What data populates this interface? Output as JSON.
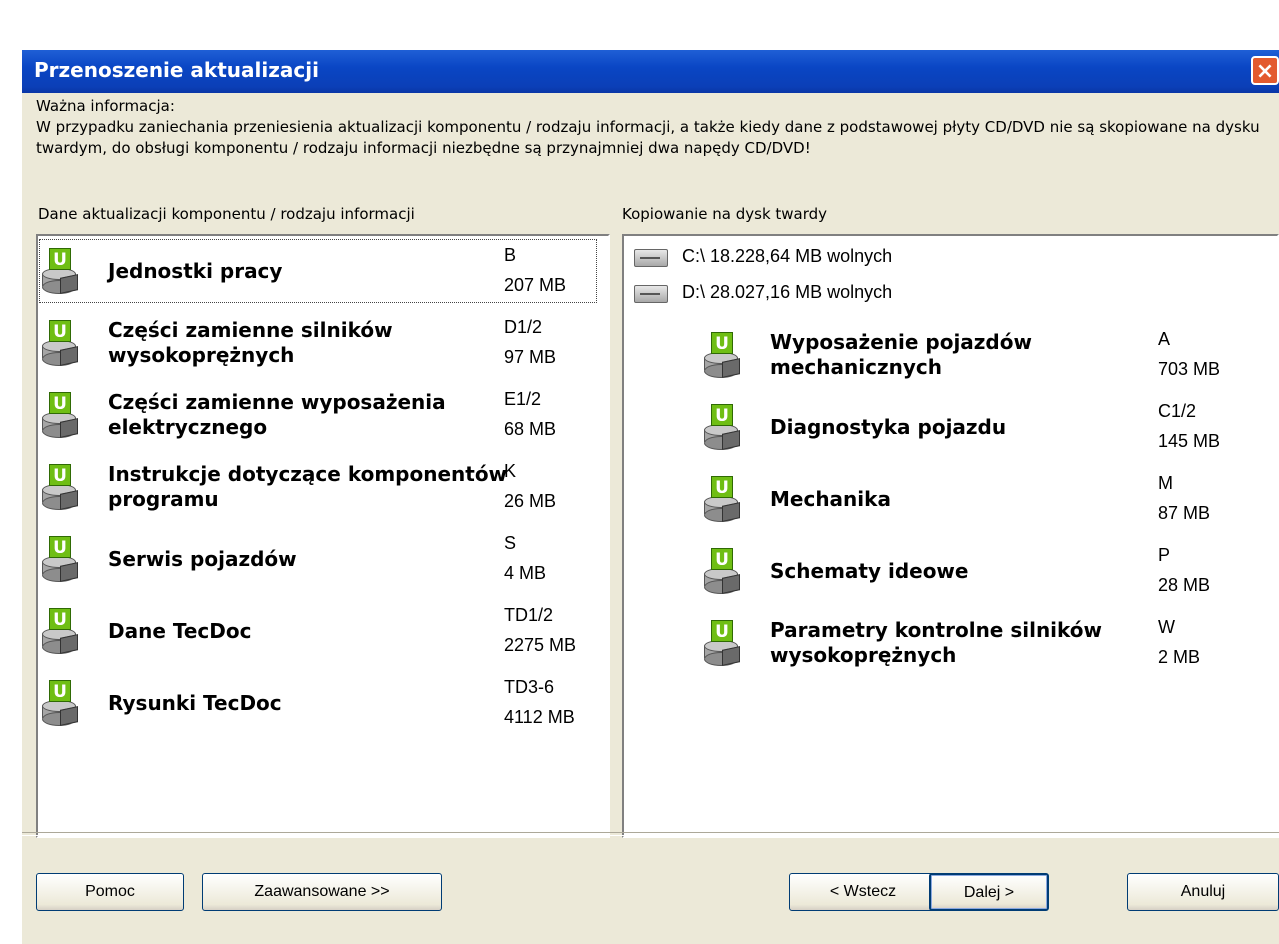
{
  "window": {
    "title": "Przenoszenie aktualizacji",
    "close_label": "×"
  },
  "info": {
    "line1": "Ważna informacja:",
    "line2": "W przypadku zaniechania przeniesienia aktualizacji komponentu / rodzaju informacji, a także kiedy dane z podstawowej płyty CD/DVD nie są skopiowane na dysku twardym, do obsługi komponentu / rodzaju informacji niezbędne są przynajmniej dwa napędy CD/DVD!"
  },
  "left_panel": {
    "label": "Dane aktualizacji komponentu / rodzaju informacji",
    "items": [
      {
        "name": "Jednostki pracy",
        "code": "B",
        "size": "207 MB"
      },
      {
        "name": "Części zamienne silników wysokoprężnych",
        "code": "D1/2",
        "size": "97 MB"
      },
      {
        "name": "Części zamienne wyposażenia elektrycznego",
        "code": "E1/2",
        "size": "68 MB"
      },
      {
        "name": "Instrukcje dotyczące komponentów programu",
        "code": "K",
        "size": "26 MB"
      },
      {
        "name": "Serwis pojazdów",
        "code": "S",
        "size": "4 MB"
      },
      {
        "name": "Dane TecDoc",
        "code": "TD1/2",
        "size": "2275 MB"
      },
      {
        "name": "Rysunki TecDoc",
        "code": "TD3-6",
        "size": "4112 MB"
      }
    ]
  },
  "right_panel": {
    "label": "Kopiowanie na dysk twardy",
    "drives": [
      {
        "label": "C:\\ 18.228,64 MB wolnych"
      },
      {
        "label": "D:\\ 28.027,16 MB wolnych"
      }
    ],
    "items": [
      {
        "name": "Wyposażenie pojazdów mechanicznych",
        "code": "A",
        "size": "703 MB"
      },
      {
        "name": "Diagnostyka pojazdu",
        "code": "C1/2",
        "size": "145 MB"
      },
      {
        "name": "Mechanika",
        "code": "M",
        "size": "87 MB"
      },
      {
        "name": "Schematy ideowe",
        "code": "P",
        "size": "28 MB"
      },
      {
        "name": "Parametry kontrolne silników wysokoprężnych",
        "code": "W",
        "size": "2 MB"
      }
    ]
  },
  "buttons": {
    "help": "Pomoc",
    "advanced": "Zaawansowane >>",
    "back": "< Wstecz",
    "next": "Dalej >",
    "cancel": "Anuluj"
  },
  "icons": {
    "component": "update-disk-icon",
    "drive": "hard-drive-icon",
    "badge_letter": "U"
  }
}
